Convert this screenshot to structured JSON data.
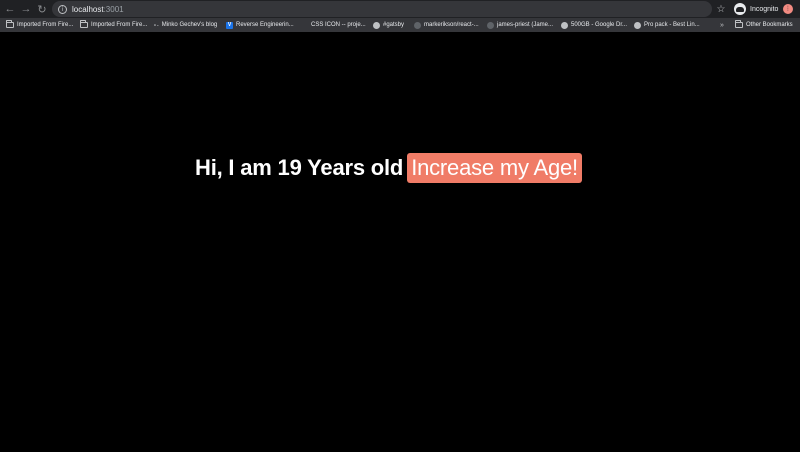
{
  "browser": {
    "url_host": "localhost",
    "url_port": ":3001",
    "profile_label": "Incognito"
  },
  "bookmarks": [
    {
      "label": "Imported From Fire...",
      "icon": "folder-icon"
    },
    {
      "label": "Imported From Fire...",
      "icon": "folder-icon"
    },
    {
      "label": "Minko Gechev's blog",
      "icon": "arrow-icon"
    },
    {
      "label": "Reverse Engineerin...",
      "icon": "v-icon"
    },
    {
      "label": "CSS ICON -- proje...",
      "icon": "none"
    },
    {
      "label": "#gatsby",
      "icon": "globe-icon"
    },
    {
      "label": "markerikson/react-...",
      "icon": "dark-icon"
    },
    {
      "label": "james-priest (Jame...",
      "icon": "dark-icon"
    },
    {
      "label": "500GB - Google Dr...",
      "icon": "globe-icon"
    },
    {
      "label": "Pro pack - Best Lin...",
      "icon": "globe-icon"
    }
  ],
  "other_bookmarks": "Other Bookmarks",
  "page": {
    "headline": "Hi, I am 19 Years old",
    "button_label": "Increase my Age!",
    "button_color": "#f07c67",
    "background": "#000000"
  }
}
